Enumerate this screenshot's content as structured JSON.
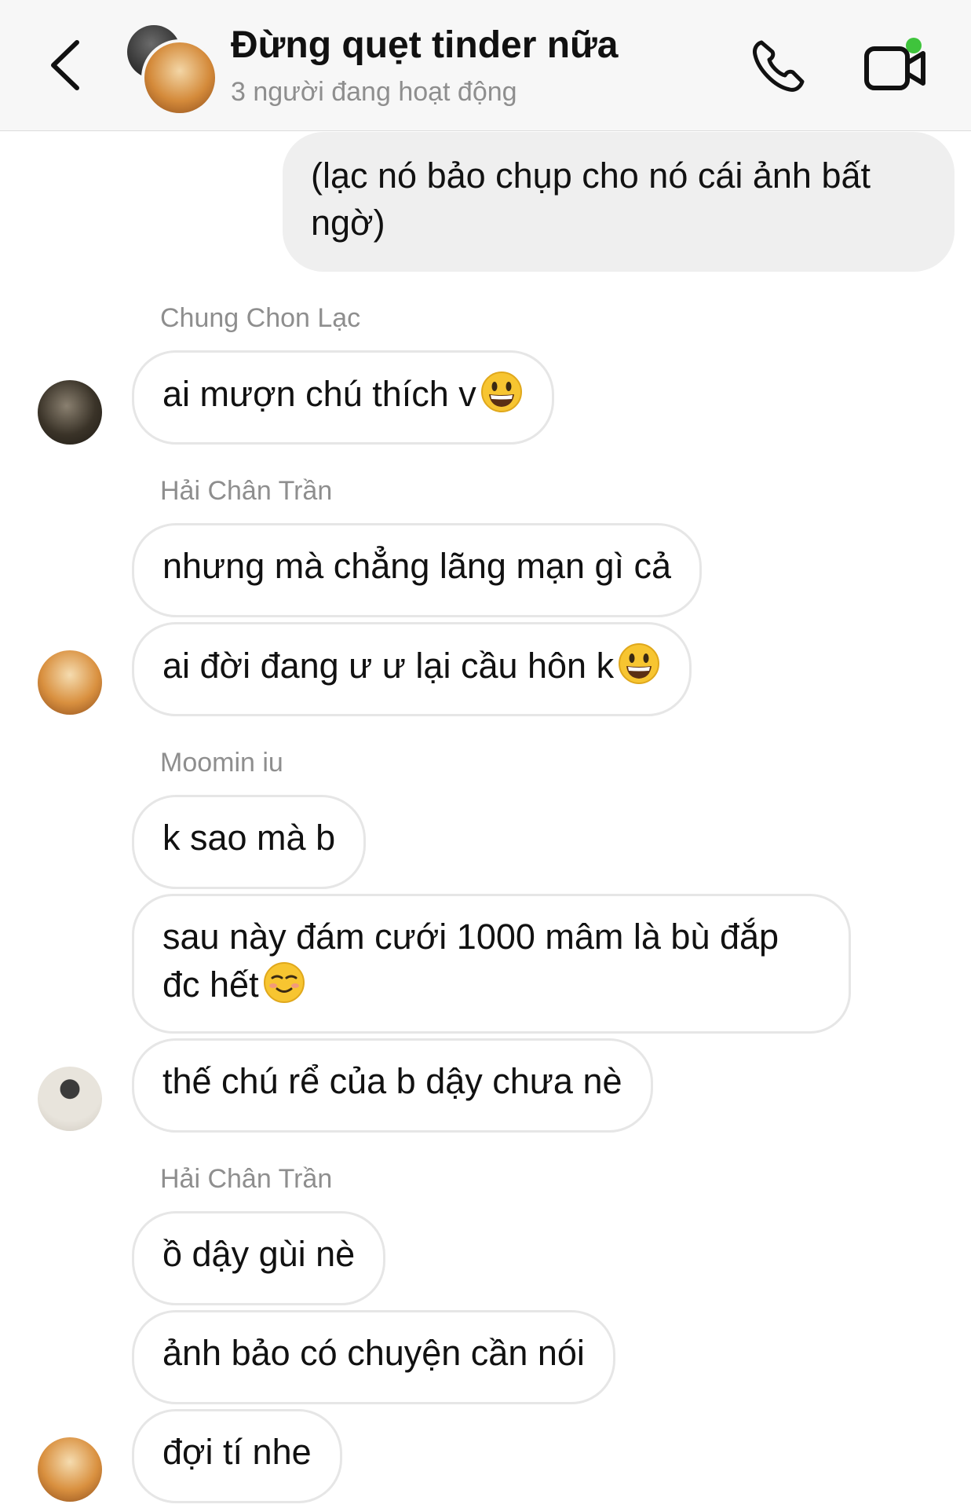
{
  "header": {
    "title": "Đừng quẹt tinder nữa",
    "subtitle": "3 người đang hoạt động",
    "accent_active": "#3fc43c"
  },
  "messages": [
    {
      "type": "out",
      "text": "(lạc nó bảo chụp cho nó cái ảnh bất ngờ)"
    },
    {
      "type": "sender",
      "text": "Chung Chon Lạc"
    },
    {
      "type": "in",
      "text": "ai mượn chú thích v",
      "emoji": "grinning-face-emoji"
    },
    {
      "type": "sender",
      "text": "Hải Chân Trần"
    },
    {
      "type": "in",
      "text": "nhưng mà chẳng lãng mạn gì cả"
    },
    {
      "type": "in",
      "text": "ai đời đang ư ư lại cầu hôn k",
      "emoji": "grinning-face-emoji"
    },
    {
      "type": "sender",
      "text": "Moomin iu"
    },
    {
      "type": "in",
      "text": "k sao mà b"
    },
    {
      "type": "in",
      "text": "sau này đám cưới 1000 mâm là bù đắp đc hết",
      "emoji": "smiling-face-emoji"
    },
    {
      "type": "in",
      "text": "thế chú rể của b dậy chưa nè"
    },
    {
      "type": "sender",
      "text": "Hải Chân Trần"
    },
    {
      "type": "in",
      "text": "ồ dậy gùi nè"
    },
    {
      "type": "in",
      "text": "ảnh bảo có chuyện cần nói"
    },
    {
      "type": "in",
      "text": "đợi tí nhe"
    }
  ]
}
